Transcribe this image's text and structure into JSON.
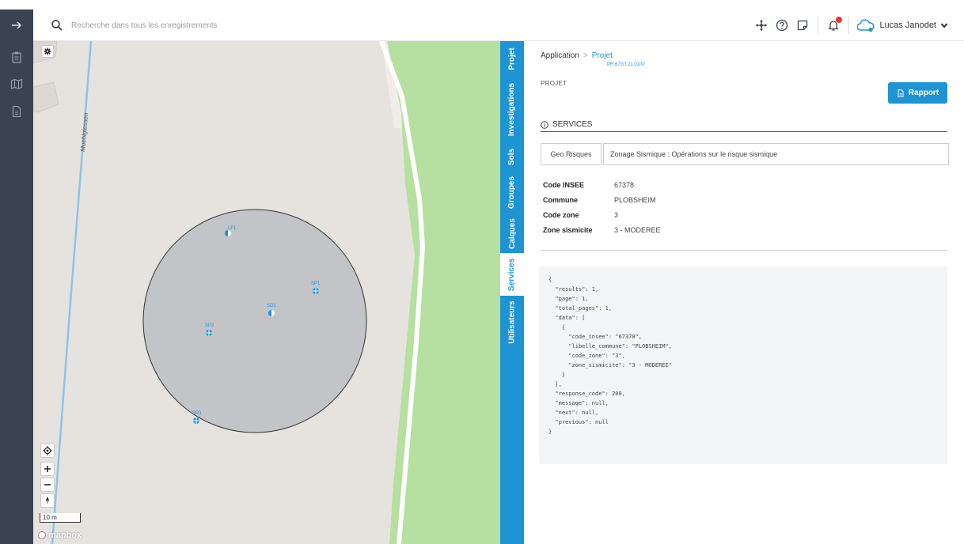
{
  "search": {
    "placeholder": "Recherche dans tous les enregistrements"
  },
  "user": {
    "name": "Lucas Janodet"
  },
  "sidebar": {
    "items": [
      {
        "icon": "clipboard-icon"
      },
      {
        "icon": "map-icon"
      },
      {
        "icon": "document-icon"
      }
    ]
  },
  "map": {
    "street_label": "Muehlgiessen",
    "points": [
      "LF1",
      "SP1",
      "SD1",
      "SP2",
      "SP3"
    ],
    "scale": "10 m",
    "attribution": "mapbox"
  },
  "vertical_tabs": [
    "Projet",
    "Investigations",
    "Sols",
    "Groupes",
    "Calques",
    "Services",
    "Utilisateurs"
  ],
  "active_tab": "Services",
  "breadcrumb": {
    "app": "Application",
    "sep": ">",
    "current": "Projet",
    "code": "PR.67GT.21.0100"
  },
  "panel": {
    "label": "PROJET",
    "report_button": "Rapport",
    "section_title": "SERVICES",
    "service_tabs": [
      "Geo Risques",
      "Zonage Sismique : Opérations sur le risque sismique"
    ],
    "info": [
      {
        "key": "Code INSEE",
        "value": "67378"
      },
      {
        "key": "Commune",
        "value": "PLOBSHEIM"
      },
      {
        "key": "Code zone",
        "value": "3"
      },
      {
        "key": "Zone sismicite",
        "value": "3 - MODEREE"
      }
    ],
    "json_response": "{\n  \"results\": 1,\n  \"page\": 1,\n  \"total_pages\": 1,\n  \"data\": [\n    {\n      \"code_insee\": \"67378\",\n      \"libelle_commune\": \"PLOBSHEIM\",\n      \"code_zone\": \"3\",\n      \"zone_sismicite\": \"3 - MODEREE\"\n    }\n  ],\n  \"response_code\": 200,\n  \"message\": null,\n  \"next\": null,\n  \"previous\": null\n}"
  },
  "colors": {
    "accent": "#1e94d3",
    "rail": "#3b4350",
    "map_ground": "#e6e3df",
    "park": "#b5e09f",
    "water": "#8cc4e8",
    "notification": "#e53935"
  }
}
